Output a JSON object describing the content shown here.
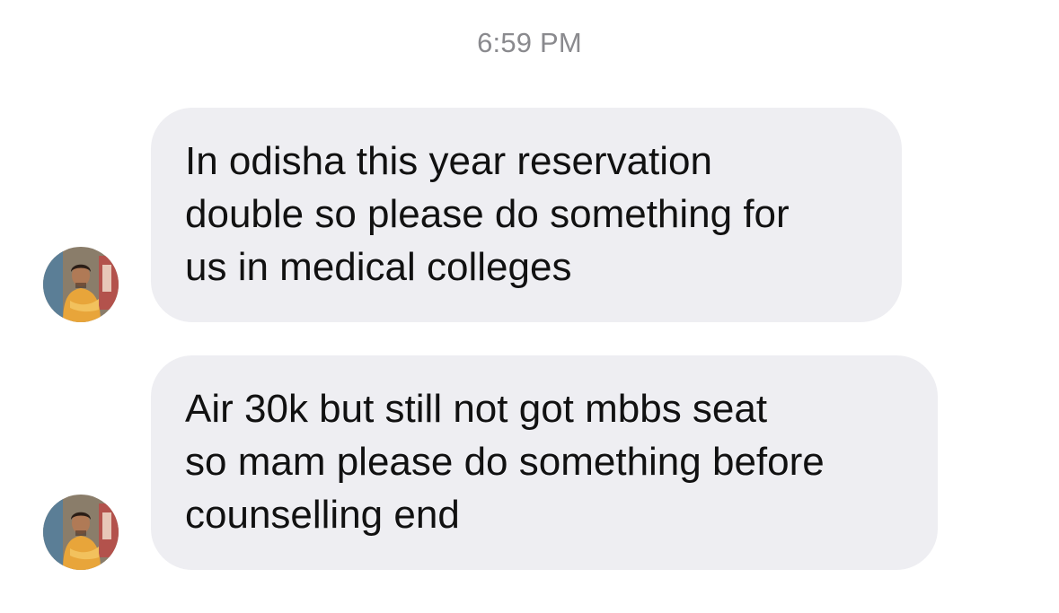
{
  "thread": {
    "timestamp": "6:59 PM",
    "messages": [
      {
        "lines": [
          "In odisha this year reservation",
          "double so please do something for",
          "us in medical colleges"
        ]
      },
      {
        "lines": [
          "Air 30k but still not got mbbs seat",
          "so mam please do something before",
          "counselling end"
        ]
      }
    ]
  },
  "colors": {
    "bubble_background": "#eeeef2",
    "message_text": "#111111",
    "timestamp_text": "#8a8a8e",
    "page_background": "#ffffff"
  },
  "icons": {
    "avatar": "sender-avatar-photo"
  }
}
